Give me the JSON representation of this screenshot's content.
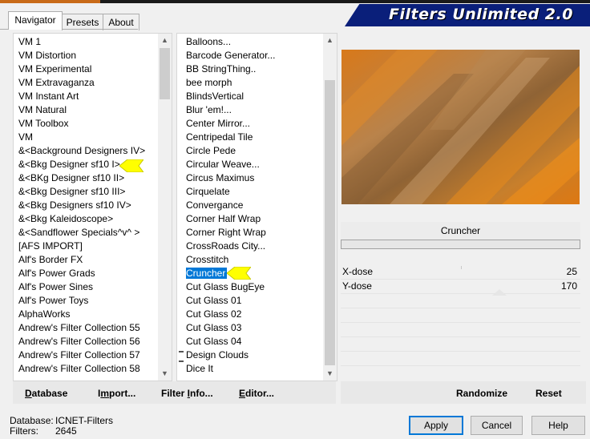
{
  "tabs": [
    {
      "label": "Navigator"
    },
    {
      "label": "Presets"
    },
    {
      "label": "About"
    }
  ],
  "banner": {
    "title": "Filters Unlimited 2.0"
  },
  "categories": [
    "VM 1",
    "VM Distortion",
    "VM Experimental",
    "VM Extravaganza",
    "VM Instant Art",
    "VM Natural",
    "VM Toolbox",
    "VM",
    "&<Background Designers IV>",
    "&<Bkg Designer sf10 I>",
    "&<BKg Designer sf10 II>",
    "&<Bkg Designer sf10 III>",
    "&<Bkg Designers sf10 IV>",
    "&<Bkg Kaleidoscope>",
    "&<Sandflower Specials^v^ >",
    "[AFS IMPORT]",
    "Alf's Border FX",
    "Alf's Power Grads",
    "Alf's Power Sines",
    "Alf's Power Toys",
    "AlphaWorks",
    "Andrew's Filter Collection 55",
    "Andrew's Filter Collection 56",
    "Andrew's Filter Collection 57",
    "Andrew's Filter Collection 58"
  ],
  "filters": [
    "Balloons...",
    "Barcode Generator...",
    "BB StringThing..",
    "bee morph",
    "BlindsVertical",
    "Blur 'em!...",
    "Center Mirror...",
    "Centripedal Tile",
    "Circle Pede",
    "Circular Weave...",
    "Circus Maximus",
    "Cirquelate",
    "Convergance",
    "Corner Half Wrap",
    "Corner Right Wrap",
    "CrossRoads City...",
    "Crosstitch",
    "Cruncher",
    "Cut Glass  BugEye",
    "Cut Glass 01",
    "Cut Glass 02",
    "Cut Glass 03",
    "Cut Glass 04",
    "Design Clouds",
    "Dice It"
  ],
  "selected_filter": "Cruncher",
  "filter_name": "Cruncher",
  "params": [
    {
      "label": "X-dose",
      "value": "25"
    },
    {
      "label": "Y-dose",
      "value": "170"
    }
  ],
  "toolbar": {
    "database_u": "D",
    "database_rest": "atabase",
    "import_pre": "I",
    "import_u": "m",
    "import_rest": "port...",
    "filterinfo_pre": "Filter ",
    "filterinfo_u": "I",
    "filterinfo_rest": "nfo...",
    "editor_u": "E",
    "editor_rest": "ditor..."
  },
  "actions": {
    "randomize": "Randomize",
    "reset": "Reset"
  },
  "status": {
    "database_label": "Database:",
    "database_value": "ICNET-Filters",
    "filters_label": "Filters:",
    "filters_value": "2645"
  },
  "buttons": {
    "apply": "Apply",
    "cancel": "Cancel",
    "help": "Help"
  },
  "colors": {
    "accent": "#0078d7",
    "banner": "#0a1f7a",
    "pointer": "#ffff00"
  }
}
